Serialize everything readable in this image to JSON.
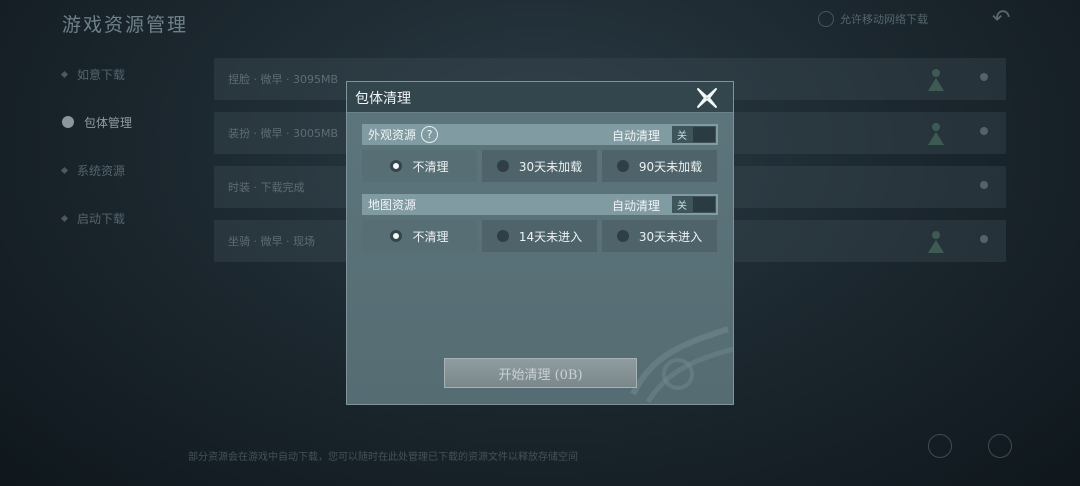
{
  "background": {
    "title": "游戏资源管理",
    "toggle_label": "允许移动网络下载",
    "sidebar": [
      {
        "label": "如意下载",
        "active": false
      },
      {
        "label": "包体管理",
        "active": true
      },
      {
        "label": "系统资源",
        "active": false
      },
      {
        "label": "启动下载",
        "active": false
      }
    ],
    "rows": [
      {
        "label": "捏脸 · 微早 · 3095MB"
      },
      {
        "label": "装扮 · 微早 · 3005MB"
      },
      {
        "label": "时装 · 下载完成"
      },
      {
        "label": "坐骑 · 微早 · 现场"
      }
    ],
    "footer": "部分资源会在游戏中自动下载，您可以随时在此处管理已下载的资源文件以释放存储空间"
  },
  "dialog": {
    "title": "包体清理",
    "sections": [
      {
        "name": "外观资源",
        "has_help": true,
        "help_glyph": "?",
        "auto_label": "自动清理",
        "switch_label": "关",
        "options": [
          {
            "label": "不清理",
            "selected": true
          },
          {
            "label": "30天未加载",
            "selected": false
          },
          {
            "label": "90天未加载",
            "selected": false
          }
        ]
      },
      {
        "name": "地图资源",
        "has_help": false,
        "help_glyph": "",
        "auto_label": "自动清理",
        "switch_label": "关",
        "options": [
          {
            "label": "不清理",
            "selected": true
          },
          {
            "label": "14天未进入",
            "selected": false
          },
          {
            "label": "30天未进入",
            "selected": false
          }
        ]
      }
    ],
    "start_button": "开始清理 (0B)"
  },
  "colors": {
    "modal_bg": "#5b737a",
    "header_bg": "#33464e",
    "section_bar": "#809ba2",
    "option_bg": "#4e636a",
    "switch_label": "#bfe4dc"
  }
}
